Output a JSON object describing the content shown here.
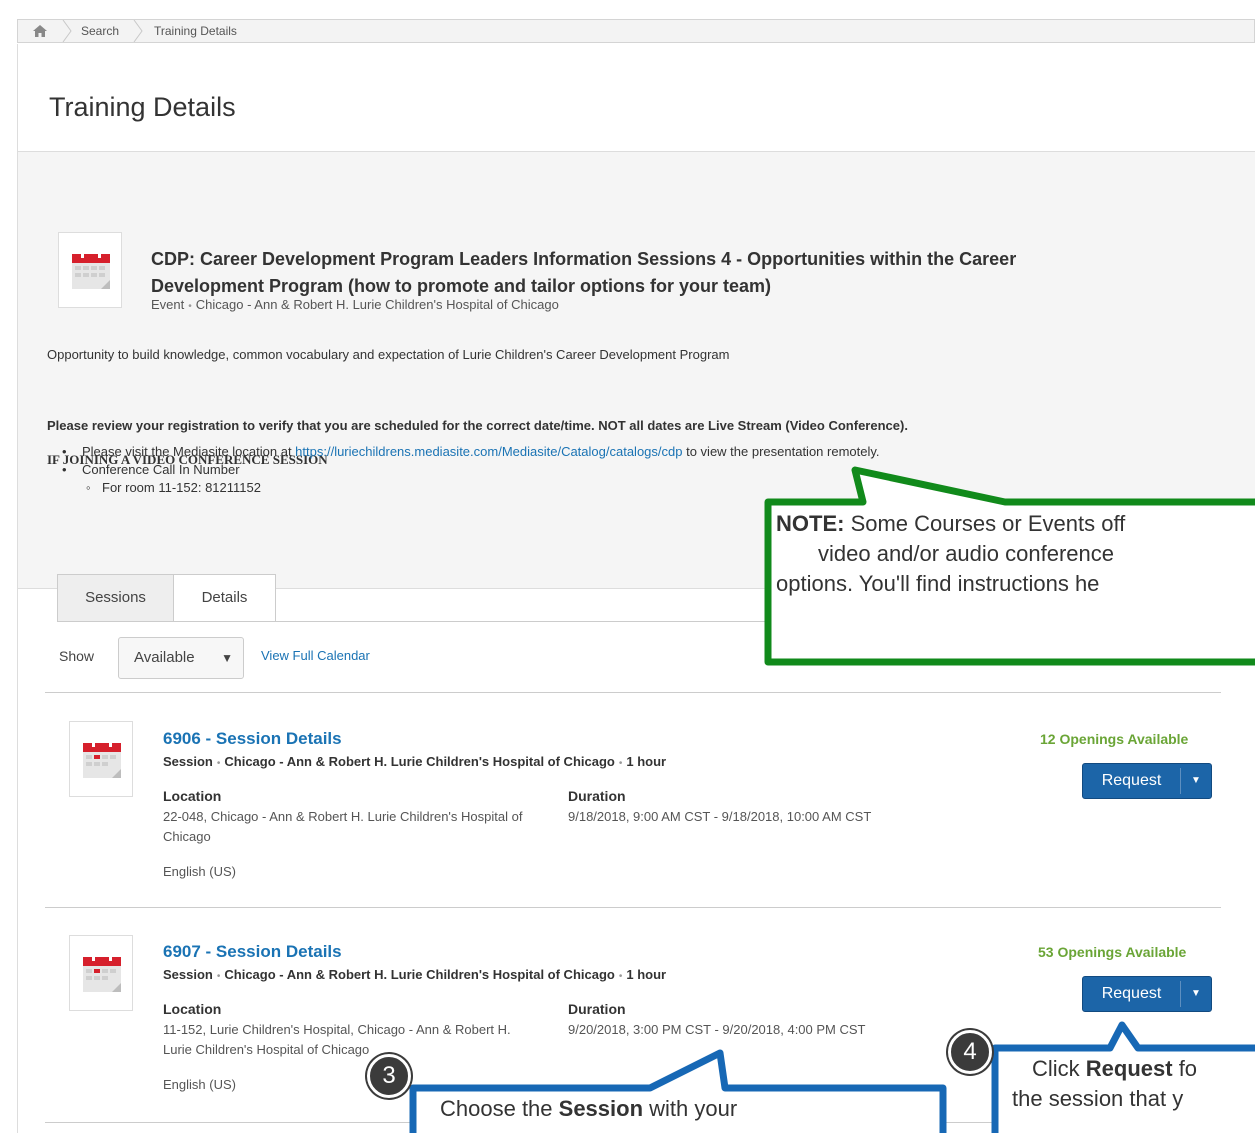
{
  "breadcrumb": {
    "home_icon": "home-icon",
    "items": [
      "Search",
      "Training Details"
    ]
  },
  "page": {
    "title": "Training Details"
  },
  "event": {
    "title": "CDP: Career Development Program Leaders Information Sessions 4 - Opportunities within the Career Development Program (how to promote and tailor options for your team)",
    "type": "Event",
    "location": "Chicago - Ann & Robert H. Lurie Children's Hospital of Chicago",
    "description": "Opportunity to build knowledge, common vocabulary and expectation of Lurie Children's Career Development Program",
    "notice": "Please review your registration to verify that you are scheduled for the correct date/time.  NOT all dates are Live Stream (Video Conference).",
    "video_heading": "IF JOINING A VIDEO CONFERENCE SESSION",
    "bullet1_before": "Please visit the Mediasite location at ",
    "bullet1_link": "https://luriechildrens.mediasite.com/Mediasite/Catalog/catalogs/cdp",
    "bullet1_after": " to view the presentation remotely.",
    "bullet2": "Conference Call In Number",
    "sub_bullet": "For room 11-152: 81211152"
  },
  "tabs": [
    {
      "label": "Sessions"
    },
    {
      "label": "Details"
    }
  ],
  "filter": {
    "show_label": "Show",
    "selected": "Available",
    "view_calendar": "View Full Calendar"
  },
  "sessions": [
    {
      "title": "6906 - Session Details",
      "type": "Session",
      "location": "Chicago - Ann & Robert H. Lurie Children's Hospital of Chicago",
      "length": "1 hour",
      "location_label": "Location",
      "location_value": "22-048, Chicago - Ann & Robert H. Lurie Children's Hospital of Chicago",
      "duration_label": "Duration",
      "duration_value": "9/18/2018, 9:00 AM CST - 9/18/2018, 10:00 AM CST",
      "language": "English (US)",
      "openings": "12 Openings Available",
      "button": "Request"
    },
    {
      "title": "6907 - Session Details",
      "type": "Session",
      "location": "Chicago - Ann & Robert H. Lurie Children's Hospital of Chicago",
      "length": "1 hour",
      "location_label": "Location",
      "location_value": "11-152, Lurie Children's Hospital, Chicago - Ann & Robert H. Lurie Children's Hospital of Chicago",
      "duration_label": "Duration",
      "duration_value": "9/20/2018, 3:00 PM CST - 9/20/2018, 4:00 PM CST",
      "language": "English (US)",
      "openings": "53 Openings Available",
      "button": "Request"
    }
  ],
  "callouts": {
    "note": {
      "bold": "NOTE:",
      "line1": " Some Courses or Events off",
      "line2": "video and/or audio conference",
      "line3": "options. You'll find instructions he",
      "color": "#118a1b"
    },
    "step3": {
      "number": "3",
      "before": "Choose the ",
      "bold": "Session",
      "after": " with your",
      "color": "#1768b5"
    },
    "step4": {
      "number": "4",
      "before": "Click ",
      "bold": "Request",
      "after": " fo",
      "line2": "the session that y",
      "color": "#1768b5"
    }
  }
}
